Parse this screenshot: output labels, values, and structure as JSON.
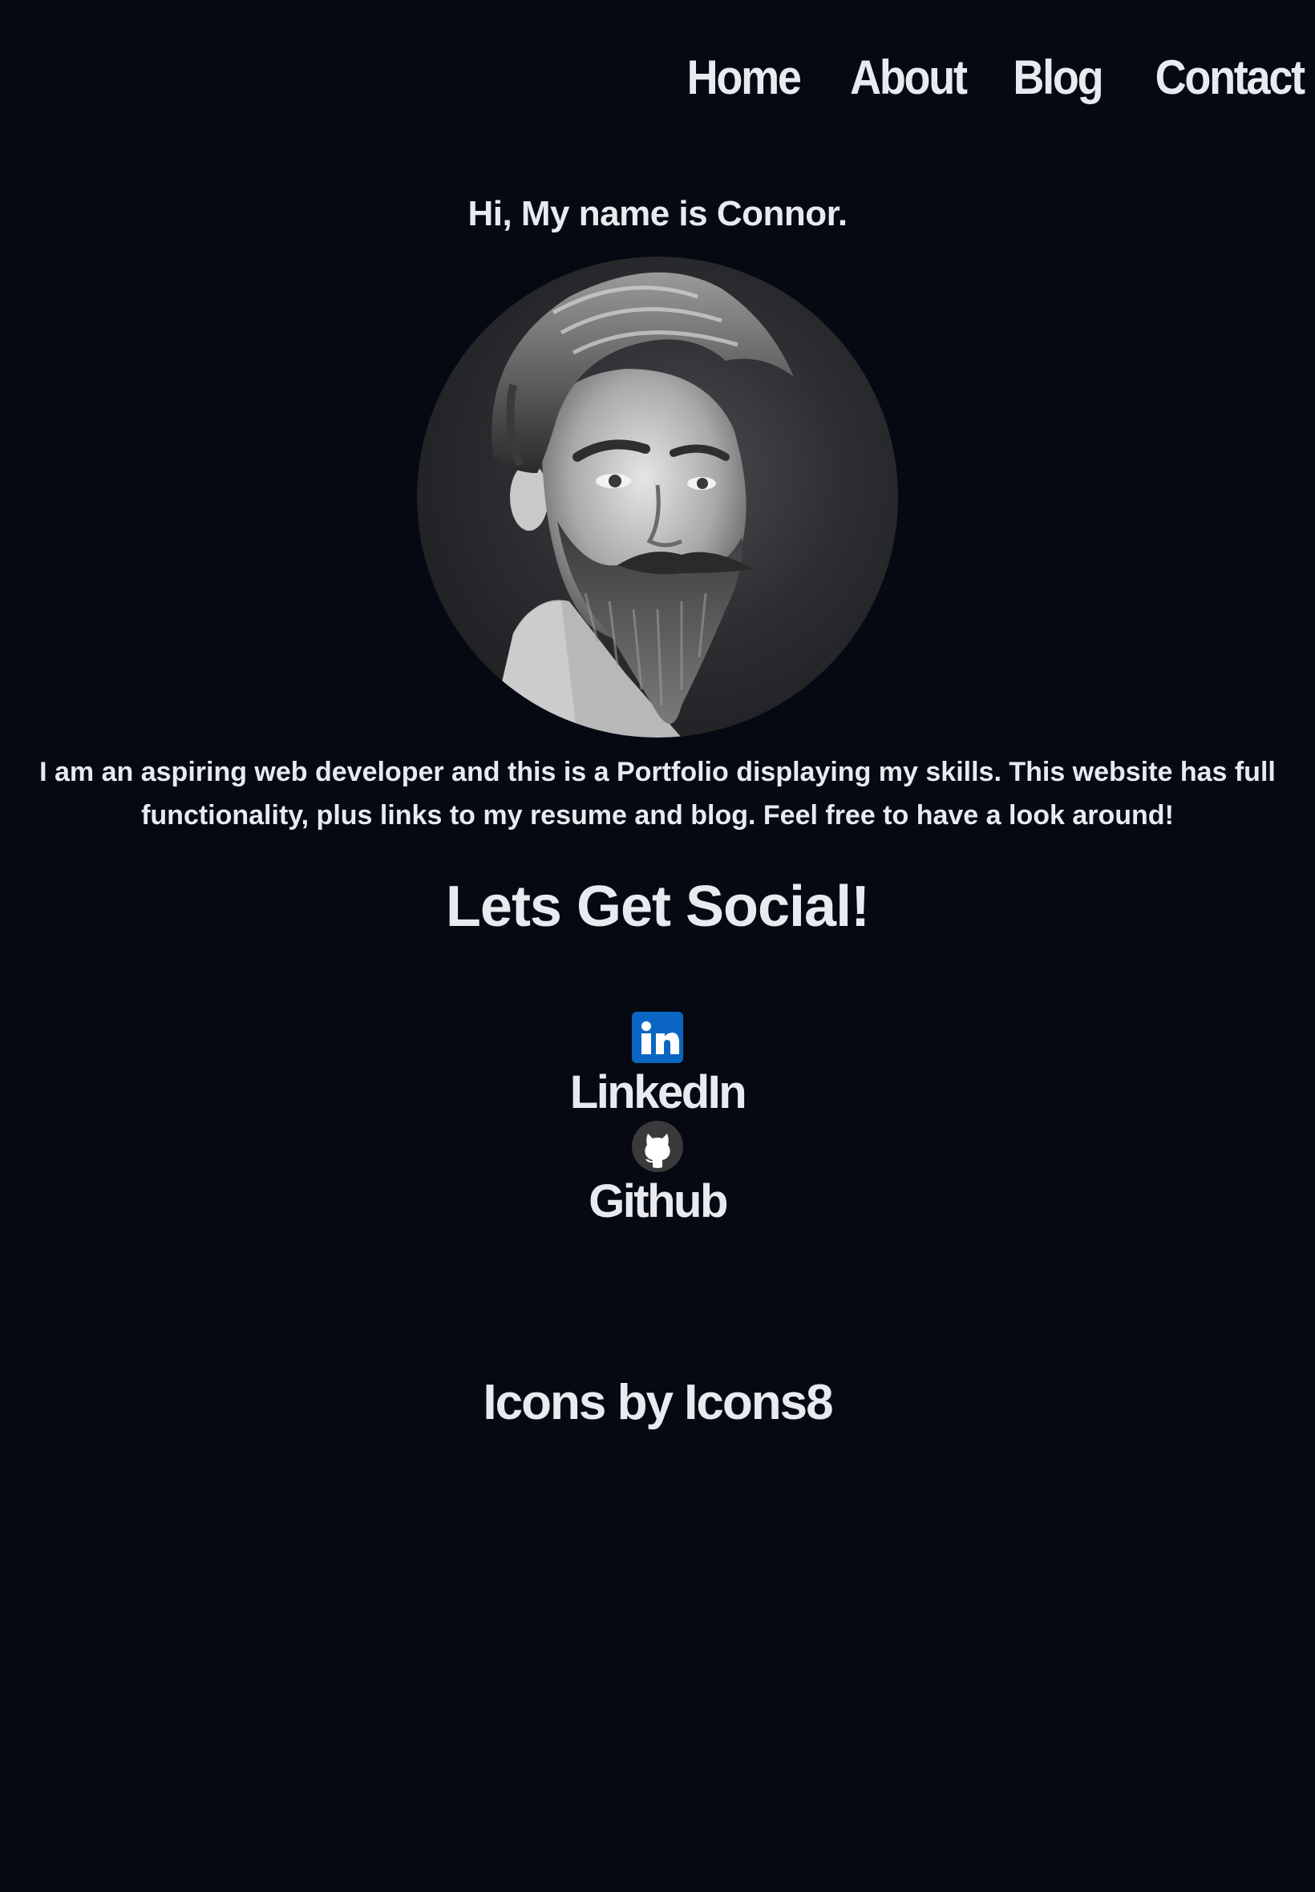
{
  "nav": {
    "items": [
      {
        "label": "Home"
      },
      {
        "label": "About"
      },
      {
        "label": "Blog"
      },
      {
        "label": "Contact"
      }
    ]
  },
  "hero": {
    "greeting": "Hi, My name is Connor.",
    "avatar_icon": "bearded-man-portrait",
    "bio": "I am an aspiring web developer and this is a Portfolio displaying my skills. This website has full functionality, plus links to my resume and blog. Feel free to have a look around!"
  },
  "social": {
    "title": "Lets Get Social!",
    "links": [
      {
        "label": "LinkedIn",
        "icon": "linkedin-icon",
        "color": "#0a66c2"
      },
      {
        "label": "Github",
        "icon": "github-icon",
        "color": "#3a3a3c"
      }
    ]
  },
  "footer": {
    "credit": "Icons by Icons8"
  },
  "colors": {
    "background": "#060912",
    "text": "#e8eaf0"
  }
}
